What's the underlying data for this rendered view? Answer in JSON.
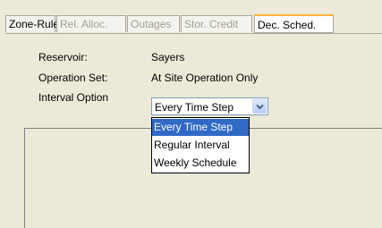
{
  "tabs": [
    {
      "label": "Zone-Rules",
      "state": "normal"
    },
    {
      "label": "Rel. Alloc.",
      "state": "disabled"
    },
    {
      "label": "Outages",
      "state": "disabled"
    },
    {
      "label": "Stor. Credit",
      "state": "disabled"
    },
    {
      "label": "Dec. Sched.",
      "state": "active"
    }
  ],
  "form": {
    "reservoir_label": "Reservoir:",
    "reservoir_value": "Sayers",
    "operation_set_label": "Operation Set:",
    "operation_set_value": "At Site Operation Only",
    "interval_label": "Interval Option",
    "interval_value": "Every Time Step"
  },
  "dropdown": {
    "options": [
      "Every Time Step",
      "Regular Interval",
      "Weekly Schedule"
    ],
    "highlighted": "Every Time Step"
  },
  "colors": {
    "window": "#ece9d8",
    "active_tab_accent": "#ffb43c",
    "selection": "#316ac5"
  },
  "icons": {
    "combo_button": "chevron-down-icon"
  }
}
